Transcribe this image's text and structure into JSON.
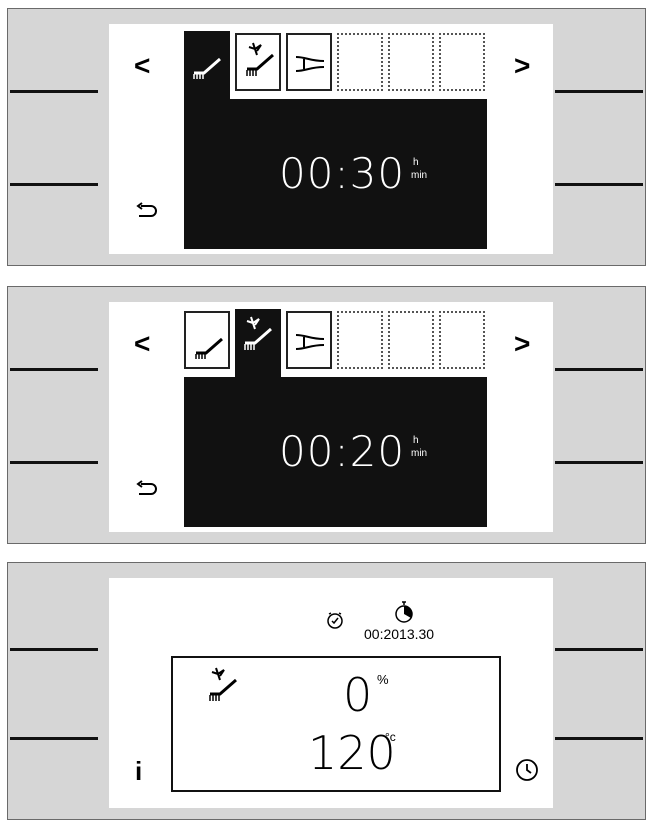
{
  "panel1": {
    "nav_left": "<",
    "nav_right": ">",
    "time": "00:30",
    "unit_top": "h",
    "unit_bottom": "min",
    "active_tab": 0
  },
  "panel2": {
    "nav_left": "<",
    "nav_right": ">",
    "time": "00:20",
    "unit_top": "h",
    "unit_bottom": "min",
    "active_tab": 1
  },
  "panel3": {
    "timer_readout": "00:2013.30",
    "percent_value": "0",
    "percent_unit": "%",
    "temp_value": "120",
    "temp_unit": "°c",
    "info_label": "i"
  },
  "icons": {
    "tab1": "brush-icon",
    "tab2": "fan-brush-icon",
    "tab3": "hose-icon",
    "back": "back-arrow-icon",
    "alarm": "alarm-clock-icon",
    "timer": "timer-icon",
    "clock": "clock-icon"
  }
}
